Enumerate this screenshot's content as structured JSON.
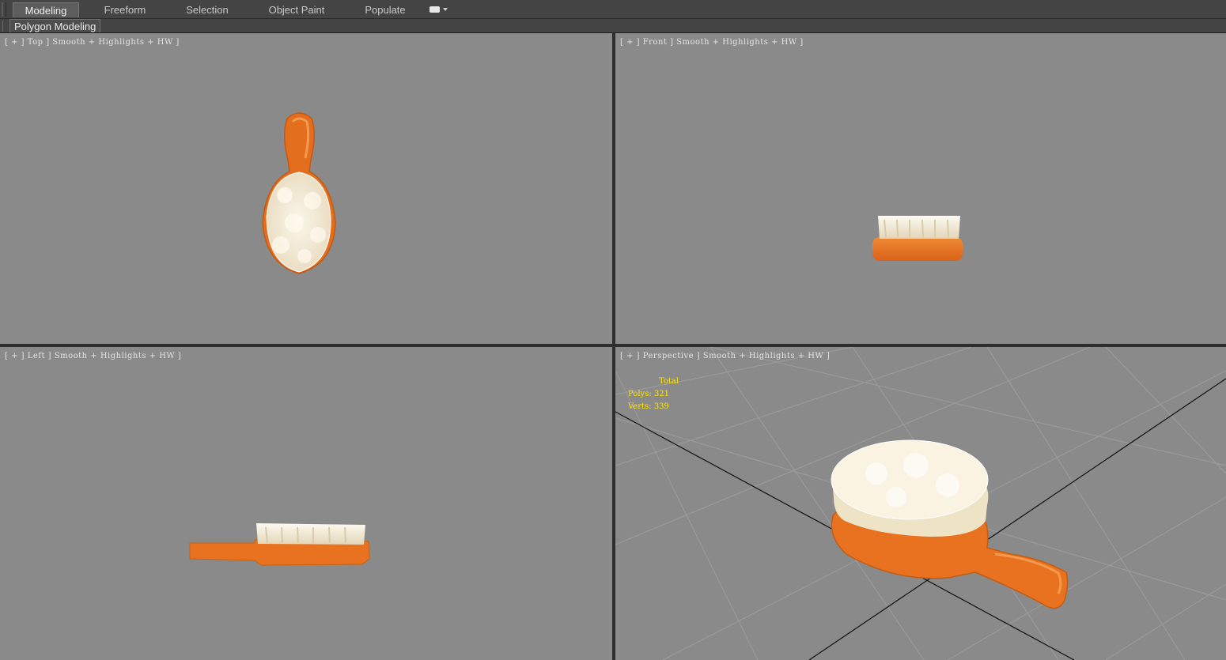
{
  "ribbon": {
    "tabs": [
      {
        "label": "Modeling",
        "active": true
      },
      {
        "label": "Freeform",
        "active": false
      },
      {
        "label": "Selection",
        "active": false
      },
      {
        "label": "Object Paint",
        "active": false
      },
      {
        "label": "Populate",
        "active": false
      }
    ],
    "dropdown_icon": "ribbon-options-icon",
    "subpanel_label": "Polygon Modeling"
  },
  "viewports": {
    "top": {
      "label": "[ + ] Top ] Smooth + Highlights + HW ]"
    },
    "front": {
      "label": "[ + ] Front ] Smooth + Highlights + HW ]"
    },
    "left": {
      "label": "[ + ] Left ] Smooth + Highlights + HW ]"
    },
    "perspective": {
      "label": "[ + ] Perspective ] Smooth + Highlights + HW ]"
    }
  },
  "stats": {
    "total_label": "Total",
    "polys": "Polys: 321",
    "verts": "Verts: 339"
  },
  "colors": {
    "viewport_bg": "#8a8a8a",
    "brush_orange": "#e8721f",
    "bristle_white": "#f4ecd8",
    "stats_yellow": "#ffe600",
    "grid_line": "#9c9c9c"
  }
}
